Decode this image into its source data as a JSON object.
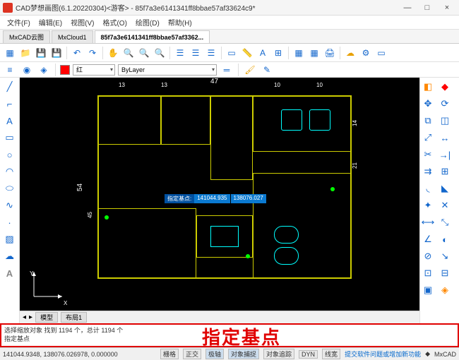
{
  "window": {
    "title": "CAD梦想画图(6.1.20220304)<游客> - 85f7a3e6141341ff8bbae57af33624c9*",
    "min": "—",
    "max": "□",
    "close": "×"
  },
  "menu": [
    "文件(F)",
    "编辑(E)",
    "视图(V)",
    "格式(O)",
    "绘图(D)",
    "帮助(H)"
  ],
  "tabs": {
    "items": [
      "MxCAD云图",
      "MxCloud1",
      "85f7a3e6141341ff8bbae57af3362..."
    ],
    "activeIndex": 2
  },
  "propbar": {
    "colorLabel": "红",
    "linetype": "ByLayer"
  },
  "canvas": {
    "tooltip": {
      "label": "指定基点:",
      "x": "141044.935",
      "y": "138076.027"
    },
    "dims_top": [
      "13",
      "13",
      "47",
      "10",
      "10"
    ],
    "dims_left": [
      "45",
      "54",
      "14",
      "21"
    ],
    "ucs_x": "X",
    "ucs_y": "Y"
  },
  "bottomTabs": [
    "模型",
    "布局1"
  ],
  "command": {
    "line1": "选择缩放对象 找到 1194 个，总计 1194 个",
    "line2": "指定基点",
    "overlay": "指定基点"
  },
  "status": {
    "coords": "141044.9348, 138076.026978, 0.000000",
    "toggles": [
      "栅格",
      "正交",
      "极轴",
      "对象捕捉",
      "对象追踪",
      "DYN",
      "线宽"
    ],
    "feedback": "提交软件问题或增加新功能",
    "brand": "MxCAD"
  }
}
